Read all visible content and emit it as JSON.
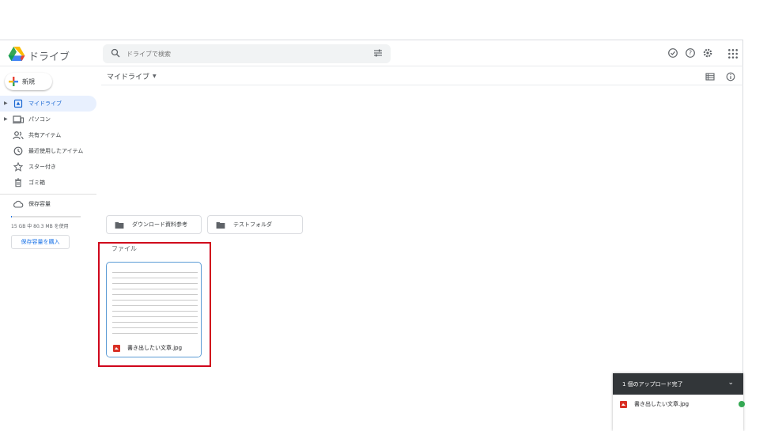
{
  "app": {
    "name": "ドライブ"
  },
  "search": {
    "placeholder": "ドライブで検索"
  },
  "sidebar": {
    "new_label": "新規",
    "items": [
      {
        "label": "マイドライブ",
        "icon": "my-drive-icon",
        "active": true
      },
      {
        "label": "パソコン",
        "icon": "computer-icon"
      },
      {
        "label": "共有アイテム",
        "icon": "shared-icon"
      },
      {
        "label": "最近使用したアイテム",
        "icon": "clock-icon"
      },
      {
        "label": "スター付き",
        "icon": "star-icon"
      },
      {
        "label": "ゴミ箱",
        "icon": "trash-icon"
      }
    ],
    "storage_label": "保存容量",
    "storage_used": "15 GB 中 80.3 MB を使用",
    "storage_fraction": 0.005,
    "buy_label": "保存容量を購入"
  },
  "main": {
    "title": "マイドライブ",
    "folders": [
      "ダウンロード資料参考",
      "テストフォルダ"
    ],
    "files_label": "ファイル",
    "files": [
      {
        "name": "書き出したい文章.jpg"
      }
    ]
  },
  "toast": {
    "title": "1 個のアップロード完了",
    "file": "書き出したい文章.jpg"
  },
  "colors": {
    "accent": "#1a73e8",
    "highlight": "#d0021b",
    "active_bg": "#e8f0fe"
  }
}
